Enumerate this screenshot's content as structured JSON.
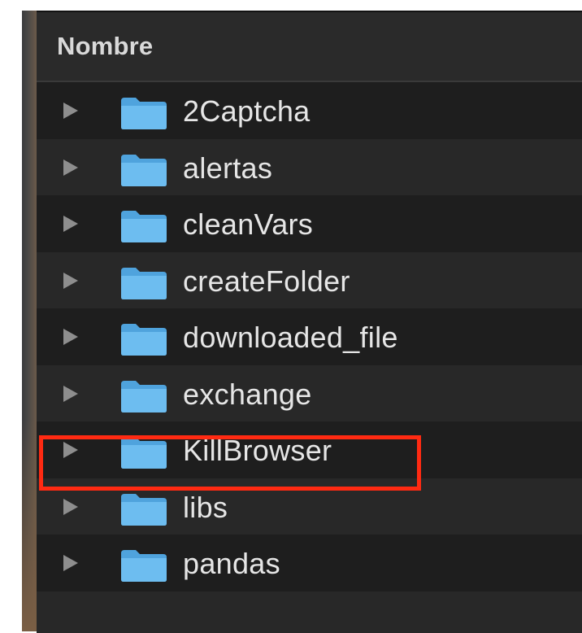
{
  "column_header": {
    "label": "Nombre"
  },
  "icons": {
    "disclosure": "disclosure-triangle-icon",
    "folder": "folder-icon"
  },
  "colors": {
    "folder_blue": "#5ab0e8",
    "highlight": "#ff2a12"
  },
  "items": [
    {
      "label": "2Captcha"
    },
    {
      "label": "alertas"
    },
    {
      "label": "cleanVars"
    },
    {
      "label": "createFolder"
    },
    {
      "label": "downloaded_file"
    },
    {
      "label": "exchange"
    },
    {
      "label": "KillBrowser"
    },
    {
      "label": "libs"
    },
    {
      "label": "pandas"
    }
  ]
}
